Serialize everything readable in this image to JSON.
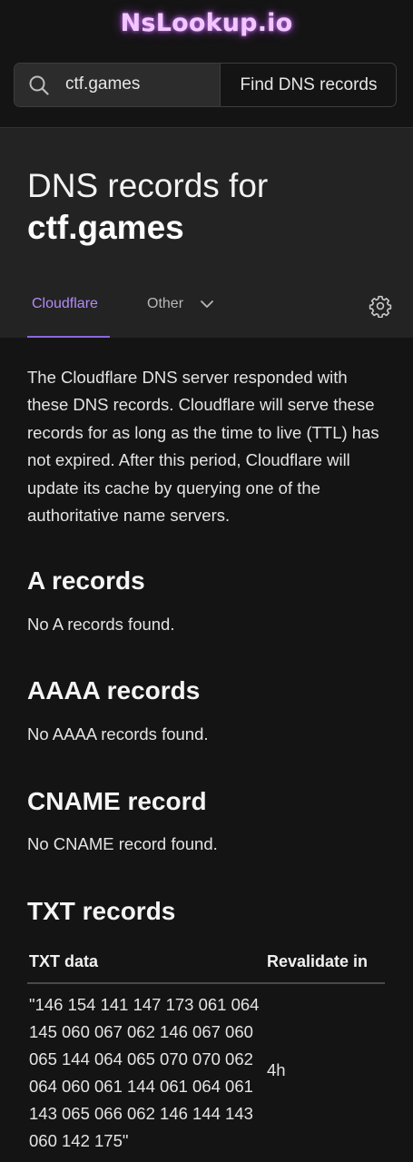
{
  "brand": {
    "logo_text": "NsLookup.io"
  },
  "search": {
    "value": "ctf.games",
    "button_label": "Find DNS records"
  },
  "header": {
    "title_prefix": "DNS records for",
    "domain": "ctf.games"
  },
  "tabs": {
    "active_label": "Cloudflare",
    "other_label": "Other",
    "settings_icon": "gear-icon"
  },
  "intro_text": "The Cloudflare DNS server responded with these DNS records. Cloudflare will serve these records for as long as the time to live (TTL) has not expired. After this period, Cloudflare will update its cache by querying one of the authoritative name servers.",
  "sections": {
    "a": {
      "title": "A records",
      "empty_text": "No A records found."
    },
    "aaaa": {
      "title": "AAAA records",
      "empty_text": "No AAAA records found."
    },
    "cname": {
      "title": "CNAME record",
      "empty_text": "No CNAME record found."
    },
    "txt": {
      "title": "TXT records",
      "columns": [
        "TXT data",
        "Revalidate in"
      ],
      "rows": [
        {
          "data": "\"146 154 141 147 173 061 064 145 060 067 062 146 067 060 065 144 064 065 070 070 062 064 060 061 144 061 064 061 143 065 066 062 146 144 143 060 142 175\"",
          "revalidate": "4h"
        }
      ]
    }
  },
  "colors": {
    "background": "#141414",
    "panel": "#232323",
    "accent": "#b18cf5",
    "logo_glow": "#d678ff"
  }
}
